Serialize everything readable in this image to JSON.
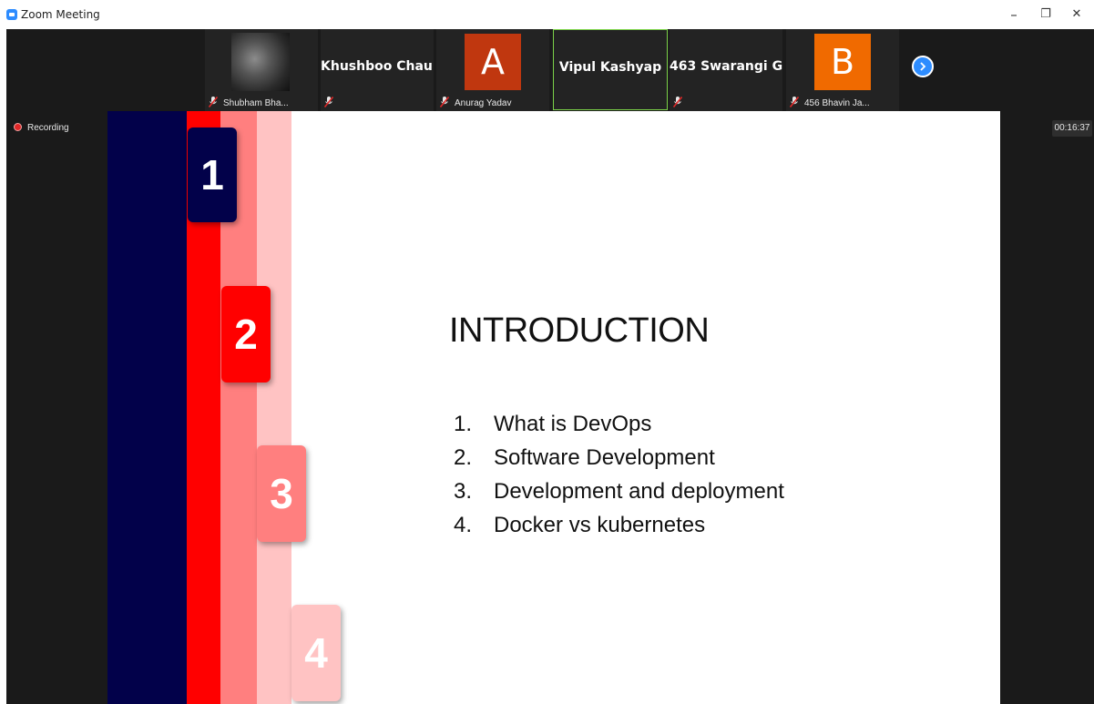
{
  "window": {
    "title": "Zoom Meeting",
    "minimize_glyph": "–",
    "restore_glyph": "❐",
    "close_glyph": "✕"
  },
  "participants": [
    {
      "name": "Shubham Bha...",
      "type": "photo",
      "muted": true
    },
    {
      "name": "Khushboo  Chau...",
      "type": "name-only",
      "muted": true
    },
    {
      "name": "Anurag Yadav",
      "type": "avatar",
      "initial": "A",
      "color": "#C0370F",
      "muted": true
    },
    {
      "name": "Vipul Kashyap",
      "type": "name-only",
      "muted": false,
      "active_speaker": true
    },
    {
      "name": "463 Swarangi G...",
      "type": "name-only",
      "muted": true
    },
    {
      "name": "456 Bhavin Ja...",
      "type": "avatar",
      "initial": "B",
      "color": "#F06A00",
      "muted": true
    }
  ],
  "recording": {
    "label": "Recording"
  },
  "timer": {
    "value": "00:16:37"
  },
  "slide": {
    "title": "INTRODUCTION",
    "items": [
      {
        "num": "1.",
        "text": "What is DevOps"
      },
      {
        "num": "2.",
        "text": "Software Development"
      },
      {
        "num": "3.",
        "text": "Development and deployment"
      },
      {
        "num": "4.",
        "text": "Docker vs kubernetes"
      }
    ],
    "steps": [
      "1",
      "2",
      "3",
      "4"
    ],
    "colors": {
      "navy": "#02014A",
      "red": "#FF0000",
      "salmon": "#FF7F7F",
      "pink": "#FFC3C3"
    }
  },
  "icons": {
    "app": "zoom-logo-icon",
    "mic": "muted-mic-icon",
    "next": "chevron-right-icon",
    "recording": "recording-dot-icon"
  }
}
